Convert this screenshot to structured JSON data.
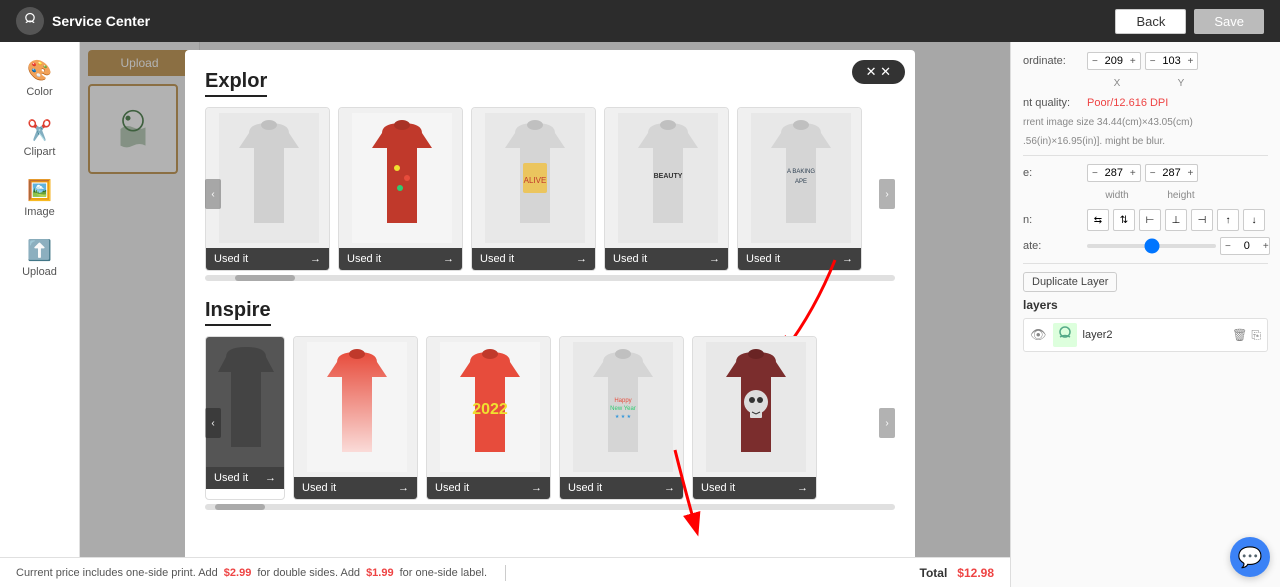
{
  "app": {
    "title": "Service Center",
    "back_label": "Back",
    "save_label": "Save"
  },
  "sidebar": {
    "items": [
      {
        "id": "color",
        "label": "Color",
        "icon": "🎨"
      },
      {
        "id": "clipart",
        "label": "Clipart",
        "icon": "✂️"
      },
      {
        "id": "image",
        "label": "Image",
        "icon": "🖼️"
      },
      {
        "id": "upload",
        "label": "Upload",
        "icon": "⬆️"
      }
    ]
  },
  "upload_tab": {
    "label": "Upload"
  },
  "right_panel": {
    "coordinate_label": "ordinate:",
    "x_val": "209",
    "y_val": "103",
    "x_label": "X",
    "y_label": "Y",
    "quality_label": "nt quality:",
    "quality_value": "Poor/12.616 DPI",
    "image_size_label": "rrent image size 34.44(cm)×43.05(cm)",
    "image_size_sub": ".56(in)×16.95(in)]. might be blur.",
    "width_val": "287",
    "height_val": "287",
    "width_label": "width",
    "height_label": "height",
    "rotate_label": "n:",
    "rotate_val": "0",
    "rotate_label2": "ate:",
    "duplicate_layer_label": "Duplicate Layer",
    "layers_label": "layers",
    "layer_name": "layer2"
  },
  "modal": {
    "close_label": "✕ ✕",
    "section1_title": "Explor",
    "section2_title": "Inspire",
    "cards_row1": [
      {
        "id": "c1",
        "color": "white",
        "label": "Used it",
        "has_print": true
      },
      {
        "id": "c2",
        "color": "red-christmas",
        "label": "Used it",
        "has_print": true
      },
      {
        "id": "c3",
        "color": "white",
        "label": "Used it",
        "has_print": true
      },
      {
        "id": "c4",
        "color": "white-beauty",
        "label": "Used it",
        "has_print": true
      },
      {
        "id": "c5",
        "color": "white-ape",
        "label": "Used it",
        "has_print": true
      }
    ],
    "cards_row2": [
      {
        "id": "r1",
        "color": "dark",
        "label": "Used it",
        "partial": true
      },
      {
        "id": "r2",
        "color": "red-gradient",
        "label": "Used it",
        "has_print": true
      },
      {
        "id": "r3",
        "color": "red-2022",
        "label": "Used it",
        "has_print": true
      },
      {
        "id": "r4",
        "color": "white-newyear",
        "label": "Used it",
        "has_print": true
      },
      {
        "id": "r5",
        "color": "dark-skull",
        "label": "Used it",
        "has_print": true
      }
    ]
  },
  "bottom_bar": {
    "text": "Current price includes one-side print. Add",
    "price1": "$2.99",
    "text2": "for double sides. Add",
    "price2": "$1.99",
    "text3": "for one-side label.",
    "total_label": "Total",
    "total_price": "$12.98"
  },
  "colors": {
    "accent": "#c8a060",
    "primary": "#c0392b",
    "quality_poor": "#e44444",
    "chat_blue": "#3b82f6"
  }
}
